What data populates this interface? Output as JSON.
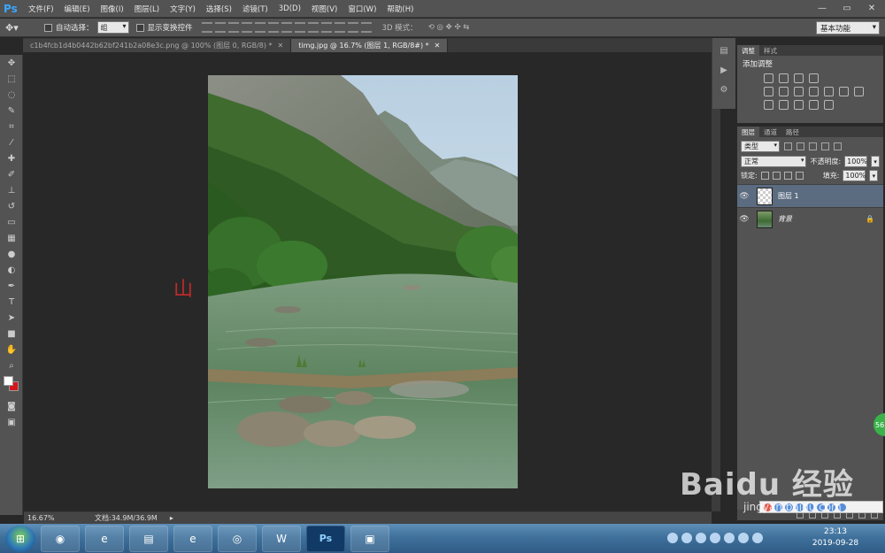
{
  "menubar": {
    "app_logo": "Ps",
    "items": [
      "文件(F)",
      "编辑(E)",
      "图像(I)",
      "图层(L)",
      "文字(Y)",
      "选择(S)",
      "滤镜(T)",
      "3D(D)",
      "视图(V)",
      "窗口(W)",
      "帮助(H)"
    ],
    "win_controls": [
      "—",
      "▭",
      "✕"
    ]
  },
  "options_bar": {
    "auto_select_label": "自动选择：",
    "auto_select_value": "组",
    "show_transform_label": "显示变换控件",
    "mode_3d_label": "3D 模式：",
    "workspace": "基本功能"
  },
  "tabs": [
    {
      "title": "c1b4fcb1d4b0442b62bf241b2a08e3c.png @ 100% (图层 0, RGB/8) *",
      "active": false
    },
    {
      "title": "timg.jpg @ 16.7% (图层 1, RGB/8#) *",
      "active": true
    }
  ],
  "canvas": {
    "overlay_char": "山"
  },
  "status": {
    "zoom": "16.67%",
    "doc_info": "文档:34.9M/36.9M"
  },
  "adjustments_panel": {
    "tabs": [
      "调整",
      "样式"
    ],
    "title": "添加调整"
  },
  "layers_panel": {
    "tabs": [
      "图层",
      "通道",
      "路径"
    ],
    "filter_kind": "类型",
    "blend_mode": "正常",
    "opacity_label": "不透明度:",
    "opacity_value": "100%",
    "lock_label": "锁定:",
    "fill_label": "填充:",
    "fill_value": "100%",
    "layers": [
      {
        "name": "图层 1",
        "selected": true,
        "locked": false
      },
      {
        "name": "背景",
        "selected": false,
        "locked": true
      }
    ]
  },
  "taskbar": {
    "time": "23:13",
    "date": "2019-09-28"
  },
  "badge": "56",
  "watermark": {
    "brand": "Baidu 经验",
    "url": "jingyan.baidu.com"
  }
}
